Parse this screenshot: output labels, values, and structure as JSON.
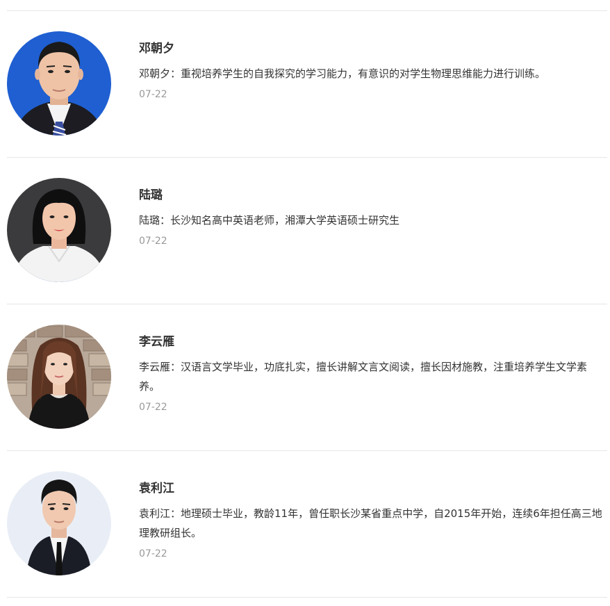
{
  "teachers": [
    {
      "name": "邓朝夕",
      "description": "邓朝夕：重视培养学生的自我探究的学习能力，有意识的对学生物理思维能力进行训练。",
      "date": "07-22",
      "avatar": "male-teacher-photo-blue-background"
    },
    {
      "name": "陆璐",
      "description": "陆璐：长沙知名高中英语老师，湘潭大学英语硕士研究生",
      "date": "07-22",
      "avatar": "female-teacher-photo-dark-background"
    },
    {
      "name": "李云雁",
      "description": "李云雁：汉语言文学毕业，功底扎实，擅长讲解文言文阅读，擅长因材施教，注重培养学生文学素养。",
      "date": "07-22",
      "avatar": "female-teacher-photo-stone-wall-background"
    },
    {
      "name": "袁利江",
      "description": "袁利江：地理硕士毕业，教龄11年，曾任职长沙某省重点中学，自2015年开始，连续6年担任高三地理教研组长。",
      "date": "07-22",
      "avatar": "male-teacher-photo-light-background"
    }
  ]
}
